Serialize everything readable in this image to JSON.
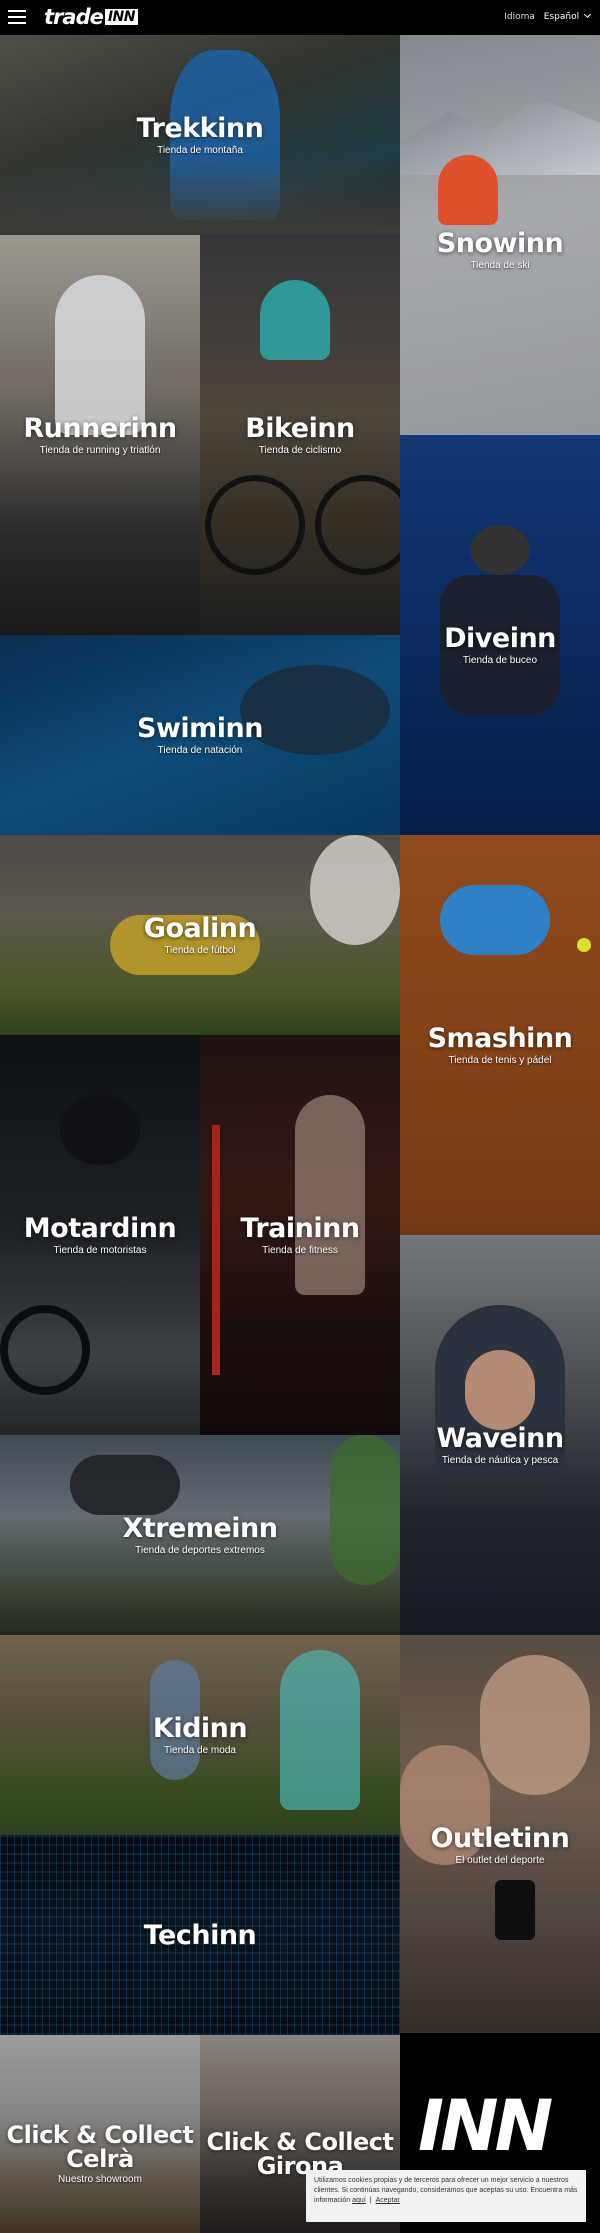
{
  "header": {
    "logo_text": "trade",
    "logo_box": "INN",
    "language_label": "Idioma",
    "language_value": "Español"
  },
  "tiles": {
    "trekkinn": {
      "title": "Trekkinn",
      "subtitle": "Tienda de montaña"
    },
    "snowinn": {
      "title": "Snowinn",
      "subtitle": "Tienda de ski"
    },
    "runnerinn": {
      "title": "Runnerinn",
      "subtitle": "Tienda de running y triatlón"
    },
    "bikeinn": {
      "title": "Bikeinn",
      "subtitle": "Tienda de ciclismo"
    },
    "diveinn": {
      "title": "Diveinn",
      "subtitle": "Tienda de buceo"
    },
    "swiminn": {
      "title": "Swiminn",
      "subtitle": "Tienda de natación"
    },
    "goalinn": {
      "title": "Goalinn",
      "subtitle": "Tienda de fútbol"
    },
    "smashinn": {
      "title": "Smashinn",
      "subtitle": "Tienda de tenis y pádel"
    },
    "motardinn": {
      "title": "Motardinn",
      "subtitle": "Tienda de motoristas"
    },
    "traininn": {
      "title": "Traininn",
      "subtitle": "Tienda de fitness"
    },
    "waveinn": {
      "title": "Waveinn",
      "subtitle": "Tienda de náutica y pesca"
    },
    "xtremeinn": {
      "title": "Xtremeinn",
      "subtitle": "Tienda de deportes extremos"
    },
    "kidinn": {
      "title": "Kidinn",
      "subtitle": "Tienda de moda"
    },
    "outletinn": {
      "title": "Outletinn",
      "subtitle": "El outlet del deporte"
    },
    "techinn": {
      "title": "Techinn",
      "subtitle": ""
    },
    "celra": {
      "title": "Click & Collect Celrà",
      "subtitle": "Nuestro showroom"
    },
    "girona": {
      "title": "Click & Collect Girona",
      "subtitle": ""
    }
  },
  "inn_logo": "INN",
  "cookie": {
    "text": "Utilizamos cookies propias y de terceros para ofrecer un mejor servicio a nuestros clientes. Si continúas navegando, consideramos que aceptas su uso. Encuentra más información",
    "link_here": "aquí",
    "link_accept": "Aceptar"
  },
  "icons": [
    "menu-icon",
    "chevron-down-icon"
  ]
}
